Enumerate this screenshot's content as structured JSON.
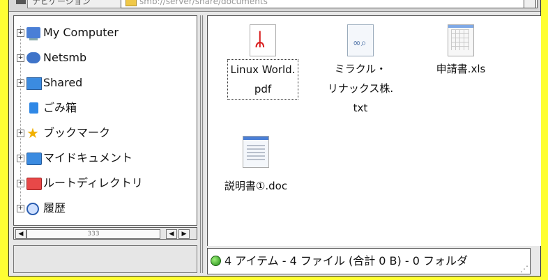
{
  "location_bar": {
    "button_label": "ナビゲーション",
    "path_text": "smb://server/share/documents"
  },
  "sidebar": {
    "items": [
      {
        "label": "My Computer",
        "icon": "computer-icon",
        "expandable": true
      },
      {
        "label": "Netsmb",
        "icon": "network-icon",
        "expandable": true
      },
      {
        "label": "Shared",
        "icon": "shared-folder-icon",
        "expandable": true
      },
      {
        "label": "ごみ箱",
        "icon": "trash-icon",
        "expandable": false
      },
      {
        "label": "ブックマーク",
        "icon": "star-icon",
        "expandable": true
      },
      {
        "label": "マイドキュメント",
        "icon": "folder-icon",
        "expandable": true
      },
      {
        "label": "ルートディレクトリ",
        "icon": "folder-red-icon",
        "expandable": true
      },
      {
        "label": "履歴",
        "icon": "history-icon",
        "expandable": true
      }
    ],
    "scroll": {
      "thumb_label": "333",
      "left_arrow": "◀",
      "right_arrow": "▶",
      "left_arrow2": "◀"
    }
  },
  "files": [
    {
      "name_line1": "Linux World.",
      "name_line2": "pdf",
      "icon": "pdf-icon",
      "selected": true
    },
    {
      "name_line1": "ミラクル・",
      "name_line2": "リナックス株.",
      "name_line3": "txt",
      "icon": "text-file-icon",
      "selected": false
    },
    {
      "name_line1": "申請書.xls",
      "icon": "spreadsheet-icon",
      "selected": false
    },
    {
      "name_line1": "説明書①.doc",
      "icon": "document-icon",
      "selected": false
    }
  ],
  "status": {
    "text": "4 アイテム - 4 ファイル (合計 0 B) - 0 フォルダ",
    "indicator_color": "#22aa22"
  },
  "colors": {
    "frame": "#ffff33",
    "window_bg": "#e8e8e8",
    "pdf_red": "#d81b1b",
    "folder_blue": "#3b8be0"
  }
}
